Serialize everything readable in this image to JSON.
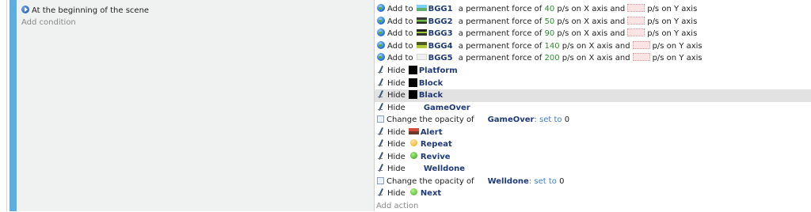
{
  "condition": {
    "title": "At the beginning of the scene",
    "add_condition": "Add condition"
  },
  "actions": {
    "forces": [
      {
        "prefix": "Add to",
        "object": "BGG1",
        "mid": "a permanent force of",
        "value": "40",
        "xtext": "p/s on X axis and",
        "ytext": "p/s on Y axis"
      },
      {
        "prefix": "Add to",
        "object": "BGG2",
        "mid": "a permanent force of",
        "value": "50",
        "xtext": "p/s on X axis and",
        "ytext": "p/s on Y axis"
      },
      {
        "prefix": "Add to",
        "object": "BGG3",
        "mid": "a permanent force of",
        "value": "90",
        "xtext": "p/s on X axis and",
        "ytext": "p/s on Y axis"
      },
      {
        "prefix": "Add to",
        "object": "BGG4",
        "mid": "a permanent force of",
        "value": "140",
        "xtext": "p/s on X axis and",
        "ytext": "p/s on Y axis"
      },
      {
        "prefix": "Add to",
        "object": "BGG5",
        "mid": "a permanent force of",
        "value": "200",
        "xtext": "p/s on X axis and",
        "ytext": "p/s on Y axis"
      }
    ],
    "hide_label": "Hide",
    "hide_platform": "Platform",
    "hide_block": "Block",
    "hide_black": "Black",
    "hide_gameover": "GameOver",
    "opacity1": {
      "label": "Change the opacity of",
      "object": "GameOver",
      "setto": ": set to",
      "value": "0"
    },
    "hide_alert": "Alert",
    "hide_repeat": "Repeat",
    "hide_revive": "Revive",
    "hide_welldone": "Welldone",
    "opacity2": {
      "label": "Change the opacity of",
      "object": "Welldone",
      "setto": ": set to",
      "value": "0"
    },
    "hide_next": "Next",
    "add_action": "Add action"
  },
  "colors": {
    "accent_bar": "#5aaee0",
    "object_name": "#1f3a7a",
    "number": "#2f8f2f",
    "link": "#3f7fc4",
    "selected_row": "#e2e2e2"
  }
}
